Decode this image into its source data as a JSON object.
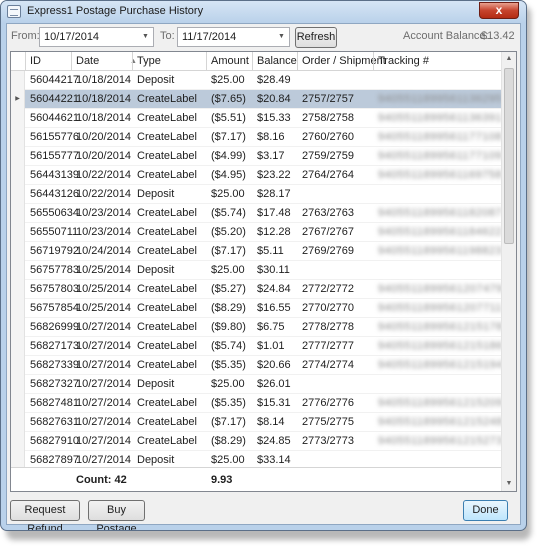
{
  "window": {
    "title": "Express1 Postage Purchase History",
    "close_glyph": "x"
  },
  "filters": {
    "from_label": "From:",
    "from_value": "10/17/2014",
    "to_label": "To:",
    "to_value": "11/17/2014",
    "refresh_label": "Refresh",
    "balance_label": "Account Balance:",
    "balance_value": "$13.42"
  },
  "grid": {
    "columns": [
      "ID",
      "Date",
      "Type",
      "Amount",
      "Balance",
      "Order / Shipment",
      "Tracking #"
    ],
    "sort_column": "Date",
    "rows": [
      {
        "id": "56044217",
        "date": "10/18/2014",
        "type": "Deposit",
        "amount": "$25.00",
        "balance": "$28.49",
        "order": "",
        "tracking": ""
      },
      {
        "id": "56044221",
        "date": "10/18/2014",
        "type": "CreateLabel",
        "amount": "($7.65)",
        "balance": "$20.84",
        "order": "2757/2757",
        "tracking": "9405511899561136295"
      },
      {
        "id": "56044621",
        "date": "10/18/2014",
        "type": "CreateLabel",
        "amount": "($5.51)",
        "balance": "$15.33",
        "order": "2758/2758",
        "tracking": "9405511899561136391"
      },
      {
        "id": "56155776",
        "date": "10/20/2014",
        "type": "CreateLabel",
        "amount": "($7.17)",
        "balance": "$8.16",
        "order": "2760/2760",
        "tracking": "9405511899561177108"
      },
      {
        "id": "56155777",
        "date": "10/20/2014",
        "type": "CreateLabel",
        "amount": "($4.99)",
        "balance": "$3.17",
        "order": "2759/2759",
        "tracking": "9405511899561177109"
      },
      {
        "id": "56443139",
        "date": "10/22/2014",
        "type": "CreateLabel",
        "amount": "($4.95)",
        "balance": "$23.22",
        "order": "2764/2764",
        "tracking": "9405511899561169758"
      },
      {
        "id": "56443126",
        "date": "10/22/2014",
        "type": "Deposit",
        "amount": "$25.00",
        "balance": "$28.17",
        "order": "",
        "tracking": ""
      },
      {
        "id": "56550634",
        "date": "10/23/2014",
        "type": "CreateLabel",
        "amount": "($5.74)",
        "balance": "$17.48",
        "order": "2763/2763",
        "tracking": "9405511899561182087"
      },
      {
        "id": "56550711",
        "date": "10/23/2014",
        "type": "CreateLabel",
        "amount": "($5.20)",
        "balance": "$12.28",
        "order": "2767/2767",
        "tracking": "9405511899561184622"
      },
      {
        "id": "56719792",
        "date": "10/24/2014",
        "type": "CreateLabel",
        "amount": "($7.17)",
        "balance": "$5.11",
        "order": "2769/2769",
        "tracking": "9405511899561198823"
      },
      {
        "id": "56757783",
        "date": "10/25/2014",
        "type": "Deposit",
        "amount": "$25.00",
        "balance": "$30.11",
        "order": "",
        "tracking": ""
      },
      {
        "id": "56757803",
        "date": "10/25/2014",
        "type": "CreateLabel",
        "amount": "($5.27)",
        "balance": "$24.84",
        "order": "2772/2772",
        "tracking": "9405511899561207479"
      },
      {
        "id": "56757854",
        "date": "10/25/2014",
        "type": "CreateLabel",
        "amount": "($8.29)",
        "balance": "$16.55",
        "order": "2770/2770",
        "tracking": "9405511899561207711"
      },
      {
        "id": "56826999",
        "date": "10/27/2014",
        "type": "CreateLabel",
        "amount": "($9.80)",
        "balance": "$6.75",
        "order": "2778/2778",
        "tracking": "9405511899561215178"
      },
      {
        "id": "56827173",
        "date": "10/27/2014",
        "type": "CreateLabel",
        "amount": "($5.74)",
        "balance": "$1.01",
        "order": "2777/2777",
        "tracking": "9405511899561215186"
      },
      {
        "id": "56827339",
        "date": "10/27/2014",
        "type": "CreateLabel",
        "amount": "($5.35)",
        "balance": "$20.66",
        "order": "2774/2774",
        "tracking": "9405511899561215194"
      },
      {
        "id": "56827327",
        "date": "10/27/2014",
        "type": "Deposit",
        "amount": "$25.00",
        "balance": "$26.01",
        "order": "",
        "tracking": ""
      },
      {
        "id": "56827481",
        "date": "10/27/2014",
        "type": "CreateLabel",
        "amount": "($5.35)",
        "balance": "$15.31",
        "order": "2776/2776",
        "tracking": "9405511899561215209"
      },
      {
        "id": "56827631",
        "date": "10/27/2014",
        "type": "CreateLabel",
        "amount": "($7.17)",
        "balance": "$8.14",
        "order": "2775/2775",
        "tracking": "9405511899561215248"
      },
      {
        "id": "56827910",
        "date": "10/27/2014",
        "type": "CreateLabel",
        "amount": "($8.29)",
        "balance": "$24.85",
        "order": "2773/2773",
        "tracking": "9405511899561215273"
      },
      {
        "id": "56827897",
        "date": "10/27/2014",
        "type": "Deposit",
        "amount": "$25.00",
        "balance": "$33.14",
        "order": "",
        "tracking": ""
      }
    ],
    "selected_row": 1,
    "footer": {
      "count_text": "Count: 42",
      "amount_total": "9.93"
    }
  },
  "buttons": {
    "request_refund": "Request Refund",
    "buy_postage": "Buy Postage",
    "done": "Done"
  },
  "colors": {
    "selected_row": "#bccada",
    "window_frame": "#b9d1ea",
    "close_button": "#c6432d"
  }
}
